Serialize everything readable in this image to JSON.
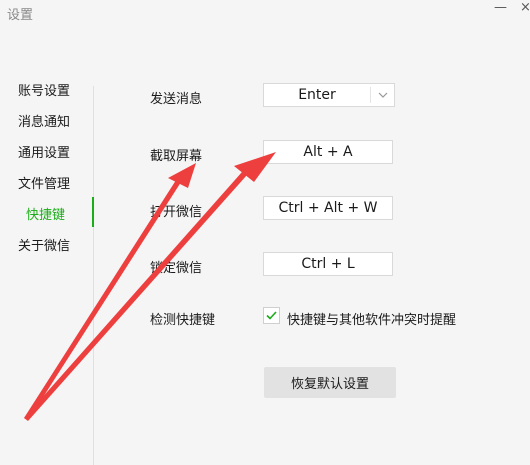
{
  "window": {
    "title": "设置",
    "minimize_glyph": "—",
    "close_glyph": "×"
  },
  "sidebar": {
    "items": [
      {
        "label": "账号设置"
      },
      {
        "label": "消息通知"
      },
      {
        "label": "通用设置"
      },
      {
        "label": "文件管理"
      },
      {
        "label": "快捷键",
        "active": true
      },
      {
        "label": "关于微信"
      }
    ]
  },
  "shortcuts": {
    "send_message": {
      "label": "发送消息",
      "value": "Enter"
    },
    "screenshot": {
      "label": "截取屏幕",
      "value": "Alt + A"
    },
    "open_wechat": {
      "label": "打开微信",
      "value": "Ctrl + Alt + W"
    },
    "lock_wechat": {
      "label": "锁定微信",
      "value": "Ctrl + L"
    },
    "detect": {
      "label": "检测快捷键",
      "checkbox_label": "快捷键与其他软件冲突时提醒",
      "checked": true
    },
    "reset_label": "恢复默认设置"
  },
  "colors": {
    "accent": "#1aad19",
    "annotation_arrow": "#ee3f3f"
  },
  "icons": [
    "chevron-down-icon",
    "check-icon",
    "minimize-icon",
    "close-icon"
  ]
}
